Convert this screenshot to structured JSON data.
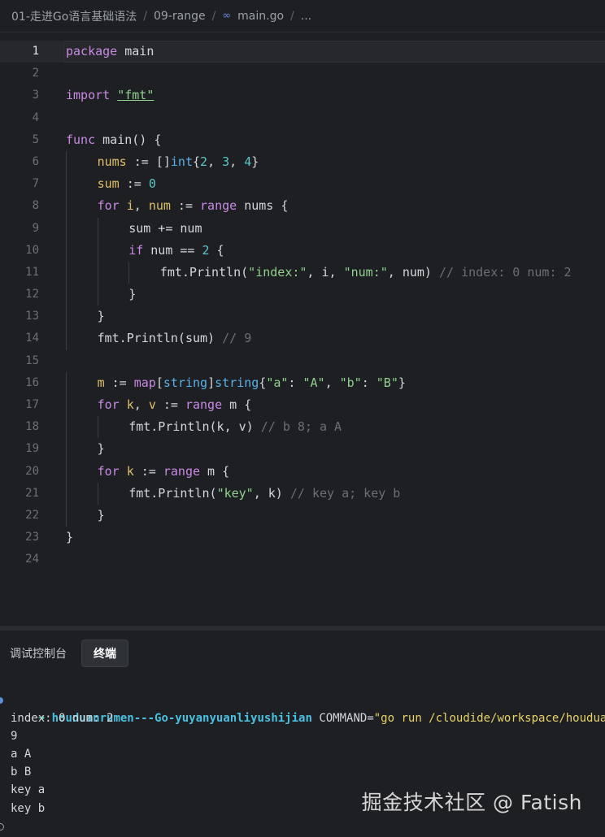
{
  "breadcrumb": {
    "items": [
      "01-走进Go语言基础语法",
      "09-range",
      "main.go",
      "..."
    ],
    "separator": "/"
  },
  "editor": {
    "active_line": 1,
    "lines": [
      {
        "n": "1",
        "indent": 0,
        "tokens": [
          [
            "kw",
            "package"
          ],
          [
            "plain",
            " main"
          ]
        ]
      },
      {
        "n": "2",
        "indent": 0,
        "tokens": []
      },
      {
        "n": "3",
        "indent": 0,
        "tokens": [
          [
            "kw",
            "import"
          ],
          [
            "plain",
            " "
          ],
          [
            "pkgstr",
            "\"fmt\""
          ]
        ]
      },
      {
        "n": "4",
        "indent": 0,
        "tokens": []
      },
      {
        "n": "5",
        "indent": 0,
        "tokens": [
          [
            "kw",
            "func"
          ],
          [
            "plain",
            " main() {"
          ]
        ]
      },
      {
        "n": "6",
        "indent": 1,
        "tokens": [
          [
            "var",
            "nums"
          ],
          [
            "plain",
            " := []"
          ],
          [
            "type",
            "int"
          ],
          [
            "plain",
            "{"
          ],
          [
            "num",
            "2"
          ],
          [
            "plain",
            ", "
          ],
          [
            "num",
            "3"
          ],
          [
            "plain",
            ", "
          ],
          [
            "num",
            "4"
          ],
          [
            "plain",
            "}"
          ]
        ]
      },
      {
        "n": "7",
        "indent": 1,
        "tokens": [
          [
            "var",
            "sum"
          ],
          [
            "plain",
            " := "
          ],
          [
            "num",
            "0"
          ]
        ]
      },
      {
        "n": "8",
        "indent": 1,
        "tokens": [
          [
            "kw",
            "for"
          ],
          [
            "plain",
            " "
          ],
          [
            "var",
            "i"
          ],
          [
            "plain",
            ", "
          ],
          [
            "var",
            "num"
          ],
          [
            "plain",
            " := "
          ],
          [
            "kw",
            "range"
          ],
          [
            "plain",
            " nums {"
          ]
        ]
      },
      {
        "n": "9",
        "indent": 2,
        "tokens": [
          [
            "plain",
            "sum += num"
          ]
        ]
      },
      {
        "n": "10",
        "indent": 2,
        "tokens": [
          [
            "kw",
            "if"
          ],
          [
            "plain",
            " num == "
          ],
          [
            "num",
            "2"
          ],
          [
            "plain",
            " {"
          ]
        ]
      },
      {
        "n": "11",
        "indent": 3,
        "tokens": [
          [
            "plain",
            "fmt.Println("
          ],
          [
            "str",
            "\"index:\""
          ],
          [
            "plain",
            ", i, "
          ],
          [
            "str",
            "\"num:\""
          ],
          [
            "plain",
            ", num) "
          ],
          [
            "cmt",
            "// index: 0 num: 2"
          ]
        ]
      },
      {
        "n": "12",
        "indent": 2,
        "tokens": [
          [
            "plain",
            "}"
          ]
        ]
      },
      {
        "n": "13",
        "indent": 1,
        "tokens": [
          [
            "plain",
            "}"
          ]
        ]
      },
      {
        "n": "14",
        "indent": 1,
        "tokens": [
          [
            "plain",
            "fmt.Println(sum) "
          ],
          [
            "cmt",
            "// 9"
          ]
        ]
      },
      {
        "n": "15",
        "indent": 0,
        "tokens": []
      },
      {
        "n": "16",
        "indent": 1,
        "tokens": [
          [
            "var",
            "m"
          ],
          [
            "plain",
            " := "
          ],
          [
            "kw",
            "map"
          ],
          [
            "plain",
            "["
          ],
          [
            "type",
            "string"
          ],
          [
            "plain",
            "]"
          ],
          [
            "type",
            "string"
          ],
          [
            "plain",
            "{"
          ],
          [
            "str",
            "\"a\""
          ],
          [
            "plain",
            ": "
          ],
          [
            "str",
            "\"A\""
          ],
          [
            "plain",
            ", "
          ],
          [
            "str",
            "\"b\""
          ],
          [
            "plain",
            ": "
          ],
          [
            "str",
            "\"B\""
          ],
          [
            "plain",
            "}"
          ]
        ]
      },
      {
        "n": "17",
        "indent": 1,
        "tokens": [
          [
            "kw",
            "for"
          ],
          [
            "plain",
            " "
          ],
          [
            "var",
            "k"
          ],
          [
            "plain",
            ", "
          ],
          [
            "var",
            "v"
          ],
          [
            "plain",
            " := "
          ],
          [
            "kw",
            "range"
          ],
          [
            "plain",
            " m {"
          ]
        ]
      },
      {
        "n": "18",
        "indent": 2,
        "tokens": [
          [
            "plain",
            "fmt.Println(k, v) "
          ],
          [
            "cmt",
            "// b 8; a A"
          ]
        ]
      },
      {
        "n": "19",
        "indent": 1,
        "tokens": [
          [
            "plain",
            "}"
          ]
        ]
      },
      {
        "n": "20",
        "indent": 1,
        "tokens": [
          [
            "kw",
            "for"
          ],
          [
            "plain",
            " "
          ],
          [
            "var",
            "k"
          ],
          [
            "plain",
            " := "
          ],
          [
            "kw",
            "range"
          ],
          [
            "plain",
            " m {"
          ]
        ]
      },
      {
        "n": "21",
        "indent": 2,
        "tokens": [
          [
            "plain",
            "fmt.Println("
          ],
          [
            "str",
            "\"key\""
          ],
          [
            "plain",
            ", k) "
          ],
          [
            "cmt",
            "// key a; key b"
          ]
        ]
      },
      {
        "n": "22",
        "indent": 1,
        "tokens": [
          [
            "plain",
            "}"
          ]
        ]
      },
      {
        "n": "23",
        "indent": 0,
        "tokens": [
          [
            "plain",
            "}"
          ]
        ]
      },
      {
        "n": "24",
        "indent": 0,
        "tokens": []
      }
    ]
  },
  "panel": {
    "tabs": [
      "调试控制台",
      "终端"
    ],
    "active_tab": 1
  },
  "terminal": {
    "prompt_arrow": "➜",
    "dir": "houduanrumen---Go-yuyanyuanliyushijian",
    "command_prefix": " COMMAND=",
    "command_string": "\"go run /cloudide/workspace/houduanrumen",
    "output": [
      "index: 0 num: 2",
      "9",
      "a A",
      "b B",
      "key a",
      "key b"
    ]
  },
  "watermark": "掘金技术社区 @ Fatish",
  "colors": {
    "background": "#1e1f22",
    "keyword": "#c98ae6",
    "string": "#8fd18d",
    "number": "#5ac8c8",
    "comment": "#6a6e75",
    "terminal_arrow": "#3ad0a8",
    "terminal_dir": "#4ac0e0"
  },
  "icons": {
    "file_link": "link-icon",
    "prompt": "circle-icon"
  }
}
